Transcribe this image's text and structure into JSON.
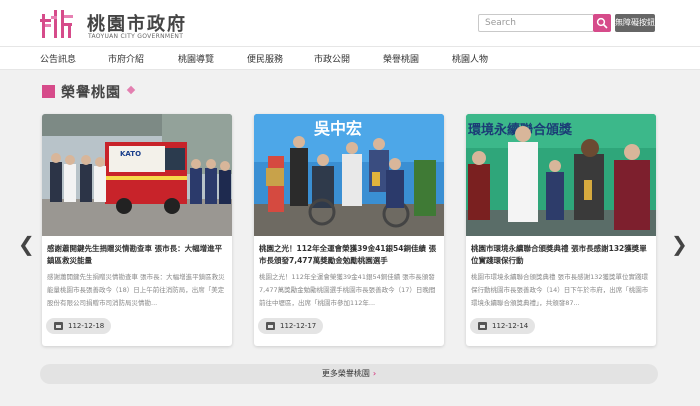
{
  "header": {
    "logo_zh": "桃園市政府",
    "logo_en": "TAOYUAN CITY GOVERNMENT",
    "search_placeholder": "Search",
    "quick_button": "無障礙按鈕",
    "accent_color": "#d64b8a"
  },
  "nav": {
    "items": [
      "公告訊息",
      "市府介紹",
      "桃園導覽",
      "便民服務",
      "市政公開",
      "榮譽桃園",
      "桃園人物"
    ]
  },
  "section": {
    "title": "榮譽桃園"
  },
  "cards": [
    {
      "title": "感謝蕭開鍵先生捐贈災情勘查車 張市長：大幅增進平鎮區救災能量",
      "desc": "感謝蕭開鍵先生捐贈災情勘查車 張市長：大幅增進平鎮區救災能量桃園市長張善政今（18）日上午前往消防局，出席「美定股份有限公司捐贈市司消防局災情勘...",
      "date": "112-12-18",
      "image_label": "KATO"
    },
    {
      "title": "桃園之光！112年全運會榮獲39金41銀54銅佳績 張市長頒發7,477萬獎勵金勉勵桃園選手",
      "desc": "桃園之光！112年全運會榮獲39金41銀54銅佳績 張市長頒發7,477萬獎勵金勉勵桃園選手桃園市長張善政今（17）日晚間前往中壢區，出席「桃園市參加112年...",
      "date": "112-12-17",
      "image_label": "吳中宏"
    },
    {
      "title": "桃園市環境永續聯合頒獎典禮 張市長感謝132獲獎單位實踐環保行動",
      "desc": "桃園市環境永續聯合頒獎典禮 張市長感謝132獲獎單位實踐環保行動桃園市長張善政今（14）日下午於市府，出席「桃園市環境永續聯合頒獎典禮」，共頒發87...",
      "date": "112-12-14",
      "image_label": "環境永續聯合頒獎"
    }
  ],
  "more_button": "更多榮譽桃園"
}
